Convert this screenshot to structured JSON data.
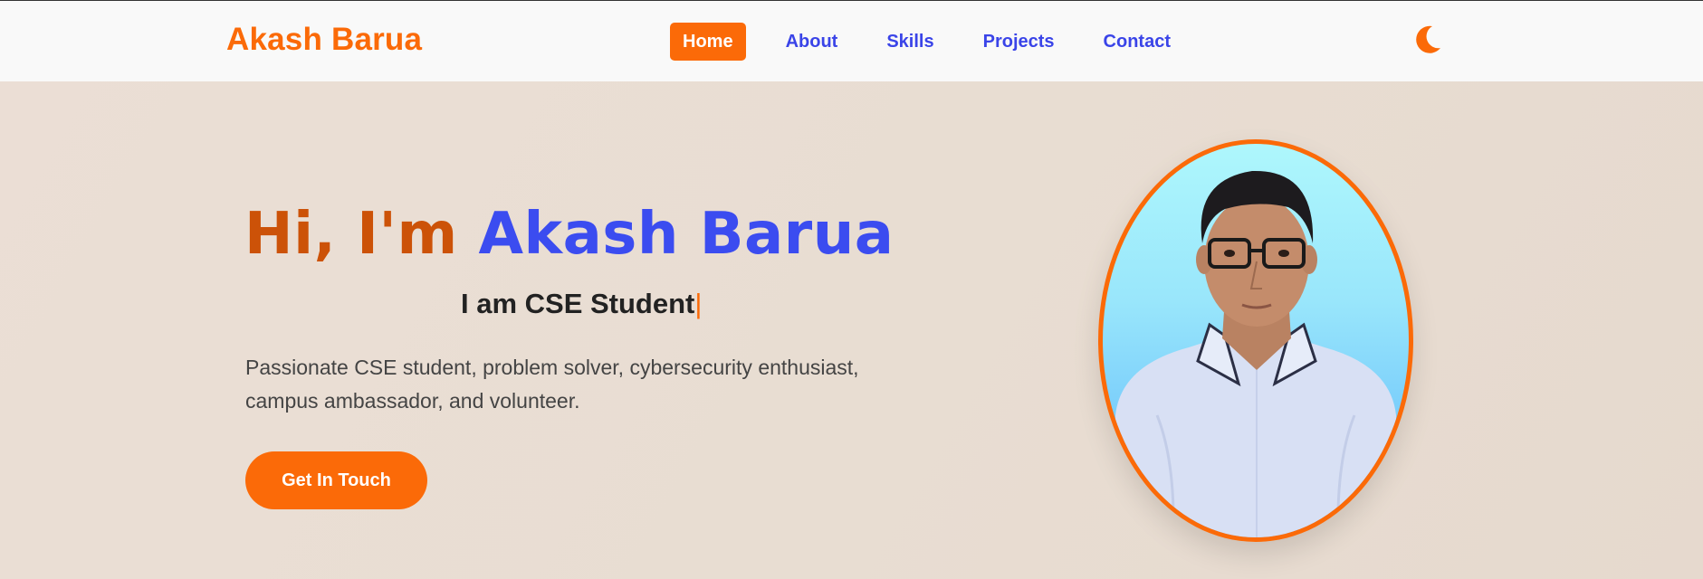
{
  "nav": {
    "brand": "Akash Barua",
    "links": [
      {
        "label": "Home",
        "active": true
      },
      {
        "label": "About",
        "active": false
      },
      {
        "label": "Skills",
        "active": false
      },
      {
        "label": "Projects",
        "active": false
      },
      {
        "label": "Contact",
        "active": false
      }
    ],
    "theme_toggle_icon": "moon-icon"
  },
  "hero": {
    "greeting": "Hi, I'm",
    "name": "Akash Barua",
    "typed_text": "I am CSE Student",
    "typing_cursor": "|",
    "intro_line1": "Passionate CSE student, problem solver, cybersecurity enthusiast,",
    "intro_line2": "campus ambassador, and volunteer.",
    "cta_label": "Get In Touch",
    "portrait_icon": "profile-photo"
  },
  "colors": {
    "accent": "#fb6a08",
    "accent_dark": "#cc5208",
    "link_blue": "#3a44e8",
    "name_blue": "#3b4cf0",
    "background": "#e9ddd2",
    "nav_bg": "#f9f9f9"
  }
}
